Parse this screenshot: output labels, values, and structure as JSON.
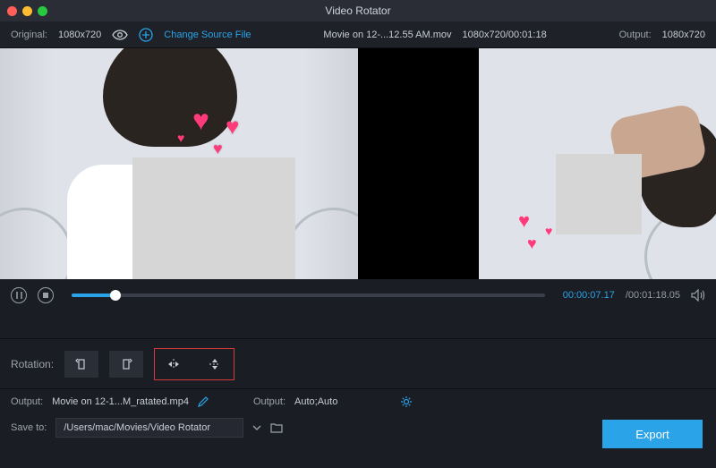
{
  "titlebar": {
    "title": "Video Rotator"
  },
  "infobar": {
    "original_label": "Original:",
    "original_res": "1080x720",
    "change_source": "Change Source File",
    "filename": "Movie on 12-...12.55 AM.mov",
    "meta": "1080x720/00:01:18",
    "output_label": "Output:",
    "output_res": "1080x720"
  },
  "playbar": {
    "current": "00:00:07.17",
    "duration": "/00:01:18.05"
  },
  "rotation": {
    "label": "Rotation:"
  },
  "output": {
    "out1_label": "Output:",
    "out1_file": "Movie on 12-1...M_ratated.mp4",
    "out2_label": "Output:",
    "out2_val": "Auto;Auto",
    "save_label": "Save to:",
    "save_path": "/Users/mac/Movies/Video Rotator"
  },
  "actions": {
    "export": "Export"
  }
}
